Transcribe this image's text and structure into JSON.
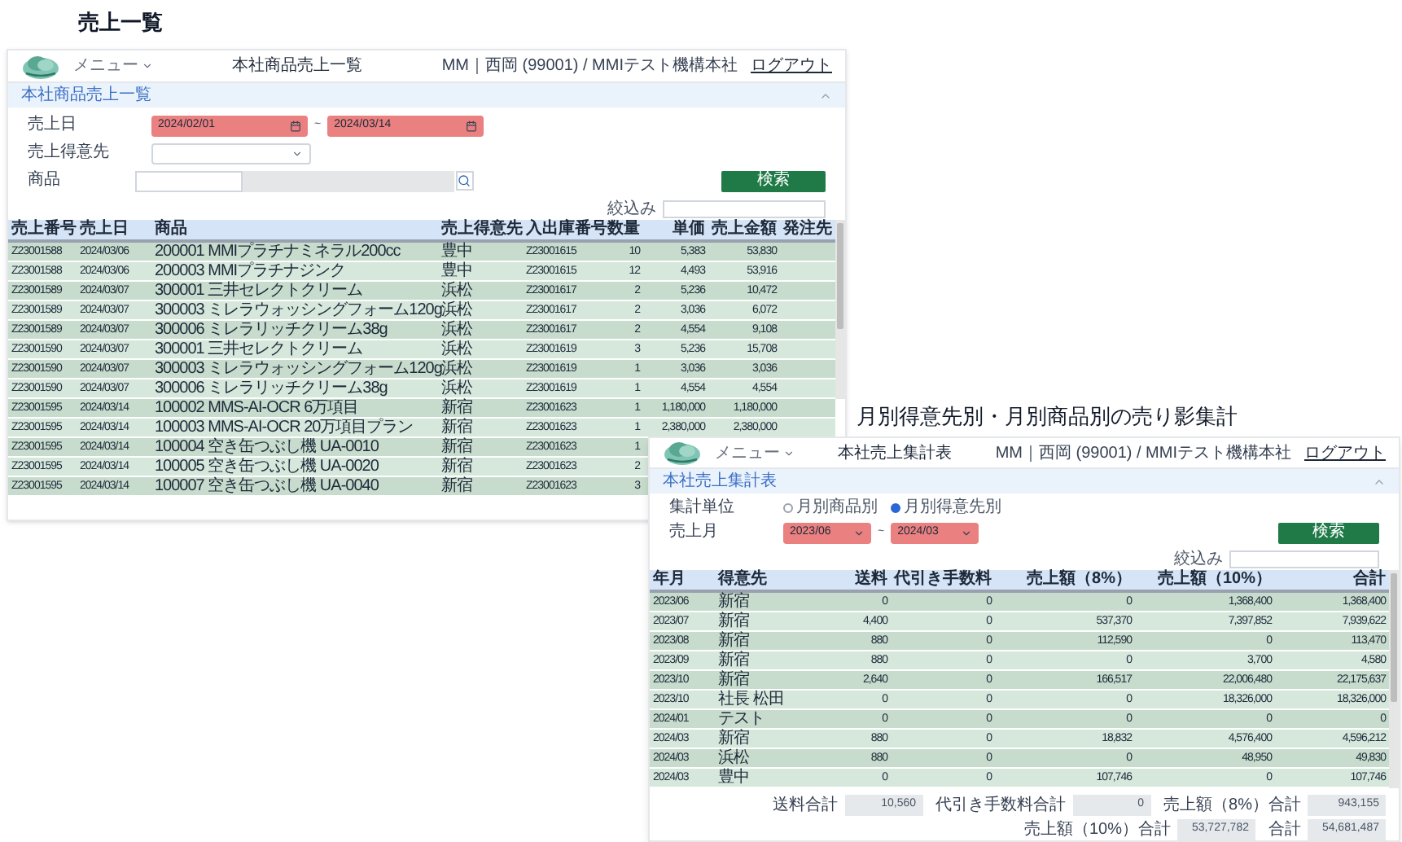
{
  "page_title": "売上一覧",
  "list_screen": {
    "menu": "メニュー",
    "title": "本社商品売上一覧",
    "user": "MM｜西岡 (99001) / MMIテスト機構本社",
    "logout": "ログアウト",
    "section": "本社商品売上一覧",
    "expanded": true,
    "fields": [
      {
        "kind": "date_range",
        "label": "売上日",
        "from": "2024/02/01",
        "to": "2024/03/14",
        "separator": "~",
        "invalid": true
      },
      {
        "kind": "select",
        "label": "売上得意先"
      },
      {
        "kind": "product",
        "label": "商品"
      }
    ],
    "search_button": "検索",
    "filter_label": "絞込み",
    "table": {
      "columns": [
        "売上番号",
        "売上日",
        "商品",
        "売上得意先",
        "入出庫番号",
        "数量",
        "単価",
        "売上金額",
        "発注先"
      ],
      "rows": [
        [
          "Z23001588",
          "2024/03/06",
          "200001 MMIプラチナミネラル200cc",
          "豊中",
          "Z23001615",
          "10",
          "5,383",
          "53,830"
        ],
        [
          "Z23001588",
          "2024/03/06",
          "200003 MMIプラチナジンク",
          "豊中",
          "Z23001615",
          "12",
          "4,493",
          "53,916"
        ],
        [
          "Z23001589",
          "2024/03/07",
          "300001 三井セレクトクリーム",
          "浜松",
          "Z23001617",
          "2",
          "5,236",
          "10,472"
        ],
        [
          "Z23001589",
          "2024/03/07",
          "300003 ミレラウォッシングフォーム120g",
          "浜松",
          "Z23001617",
          "2",
          "3,036",
          "6,072"
        ],
        [
          "Z23001589",
          "2024/03/07",
          "300006 ミレラリッチクリーム38g",
          "浜松",
          "Z23001617",
          "2",
          "4,554",
          "9,108"
        ],
        [
          "Z23001590",
          "2024/03/07",
          "300001 三井セレクトクリーム",
          "浜松",
          "Z23001619",
          "3",
          "5,236",
          "15,708"
        ],
        [
          "Z23001590",
          "2024/03/07",
          "300003 ミレラウォッシングフォーム120g",
          "浜松",
          "Z23001619",
          "1",
          "3,036",
          "3,036"
        ],
        [
          "Z23001590",
          "2024/03/07",
          "300006 ミレラリッチクリーム38g",
          "浜松",
          "Z23001619",
          "1",
          "4,554",
          "4,554"
        ],
        [
          "Z23001595",
          "2024/03/14",
          "100002 MMS-AI-OCR 6万項目",
          "新宿",
          "Z23001623",
          "1",
          "1,180,000",
          "1,180,000"
        ],
        [
          "Z23001595",
          "2024/03/14",
          "100003 MMS-AI-OCR 20万項目プラン",
          "新宿",
          "Z23001623",
          "1",
          "2,380,000",
          "2,380,000"
        ],
        [
          "Z23001595",
          "2024/03/14",
          "100004 空き缶つぶし機 UA-0010",
          "新宿",
          "Z23001623",
          "1"
        ],
        [
          "Z23001595",
          "2024/03/14",
          "100005 空き缶つぶし機 UA-0020",
          "新宿",
          "Z23001623",
          "2"
        ],
        [
          "Z23001595",
          "2024/03/14",
          "100007 空き缶つぶし機 UA-0040",
          "新宿",
          "Z23001623",
          "3"
        ]
      ]
    }
  },
  "summary_title": "月別得意先別・月別商品別の売り影集計",
  "summary_screen": {
    "menu": "メニュー",
    "title": "本社売上集計表",
    "user": "MM｜西岡 (99001) / MMIテスト機構本社",
    "logout": "ログアウト",
    "section": "本社売上集計表",
    "expanded": true,
    "unit": {
      "label": "集計単位",
      "options": [
        {
          "label": "月別商品別",
          "selected": false
        },
        {
          "label": "月別得意先別",
          "selected": true
        }
      ]
    },
    "month": {
      "label": "売上月",
      "from": "2023/06",
      "to": "2024/03",
      "separator": "~",
      "invalid": true
    },
    "search_button": "検索",
    "filter_label": "絞込み",
    "table": {
      "columns": [
        "年月",
        "得意先",
        "送料",
        "代引き手数料",
        "売上額（8%）",
        "売上額（10%）",
        "合計"
      ],
      "rows": [
        [
          "2023/06",
          "新宿",
          "0",
          "0",
          "0",
          "1,368,400",
          "1,368,400"
        ],
        [
          "2023/07",
          "新宿",
          "4,400",
          "0",
          "537,370",
          "7,397,852",
          "7,939,622"
        ],
        [
          "2023/08",
          "新宿",
          "880",
          "0",
          "112,590",
          "0",
          "113,470"
        ],
        [
          "2023/09",
          "新宿",
          "880",
          "0",
          "0",
          "3,700",
          "4,580"
        ],
        [
          "2023/10",
          "新宿",
          "2,640",
          "0",
          "166,517",
          "22,006,480",
          "22,175,637"
        ],
        [
          "2023/10",
          "社長 松田",
          "0",
          "0",
          "0",
          "18,326,000",
          "18,326,000"
        ],
        [
          "2024/01",
          "テスト",
          "0",
          "0",
          "0",
          "0",
          "0"
        ],
        [
          "2024/03",
          "新宿",
          "880",
          "0",
          "18,832",
          "4,576,400",
          "4,596,212"
        ],
        [
          "2024/03",
          "浜松",
          "880",
          "0",
          "0",
          "48,950",
          "49,830"
        ],
        [
          "2024/03",
          "豊中",
          "0",
          "0",
          "107,746",
          "0",
          "107,746"
        ]
      ]
    },
    "totals": [
      {
        "label": "送料合計",
        "value": "10,560"
      },
      {
        "label": "代引き手数料合計",
        "value": "0"
      },
      {
        "label": "売上額（8%）合計",
        "value": "943,155"
      },
      {
        "label": "売上額（10%）合計",
        "value": "53,727,782"
      },
      {
        "label": "合計",
        "value": "54,681,487"
      }
    ]
  }
}
